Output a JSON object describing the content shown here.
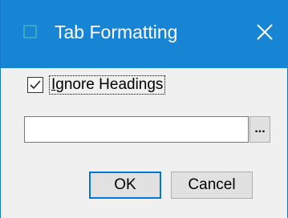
{
  "window": {
    "title": "Tab Formatting",
    "titlebar_color": "#1884d4",
    "close_icon": "close-icon",
    "app_icon": "window-app-icon"
  },
  "form": {
    "ignore_headings": {
      "label_accel": "I",
      "label_rest": "gnore Headings",
      "checked": true
    },
    "path_field": {
      "value": ""
    },
    "browse_label": "..."
  },
  "buttons": {
    "ok_label": "OK",
    "cancel_label": "Cancel"
  }
}
